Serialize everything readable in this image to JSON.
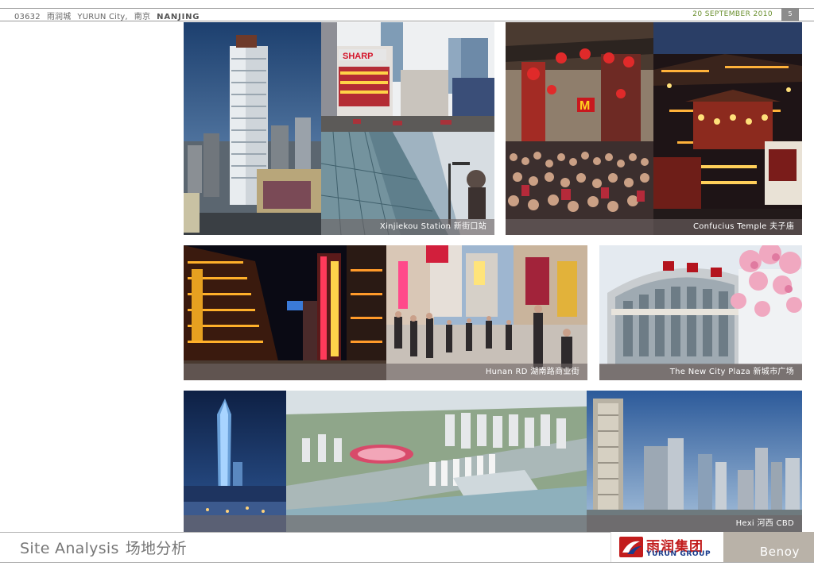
{
  "header": {
    "project_code": "03632",
    "project_cn": "雨润城",
    "project_en": "YURUN City,",
    "city_cn": "南京",
    "city_en": "NANJING",
    "date": "20 SEPTEMBER 2010",
    "page_number": "5"
  },
  "photos": {
    "row1": {
      "caption_left": "Xinjiekou Station 新街口站",
      "caption_right": "Confucius Temple 夫子庙",
      "sign_sharp": "SHARP"
    },
    "row2": {
      "caption_left": "Hunan RD 湖南路商业街",
      "caption_right": "The New City Plaza 新城市广场"
    },
    "row3": {
      "caption_right": "Hexi 河西 CBD"
    }
  },
  "footer": {
    "title_en": "Site Analysis",
    "title_cn": "场地分析",
    "logo_cn": "雨润集团",
    "logo_en": "YURUN GROUP",
    "brand": "Benoy"
  },
  "colors": {
    "date_green": "#6a8f2e",
    "logo_red": "#c21d1d",
    "logo_blue": "#1a3c8c",
    "benoy_bg": "#b9b2a8"
  }
}
